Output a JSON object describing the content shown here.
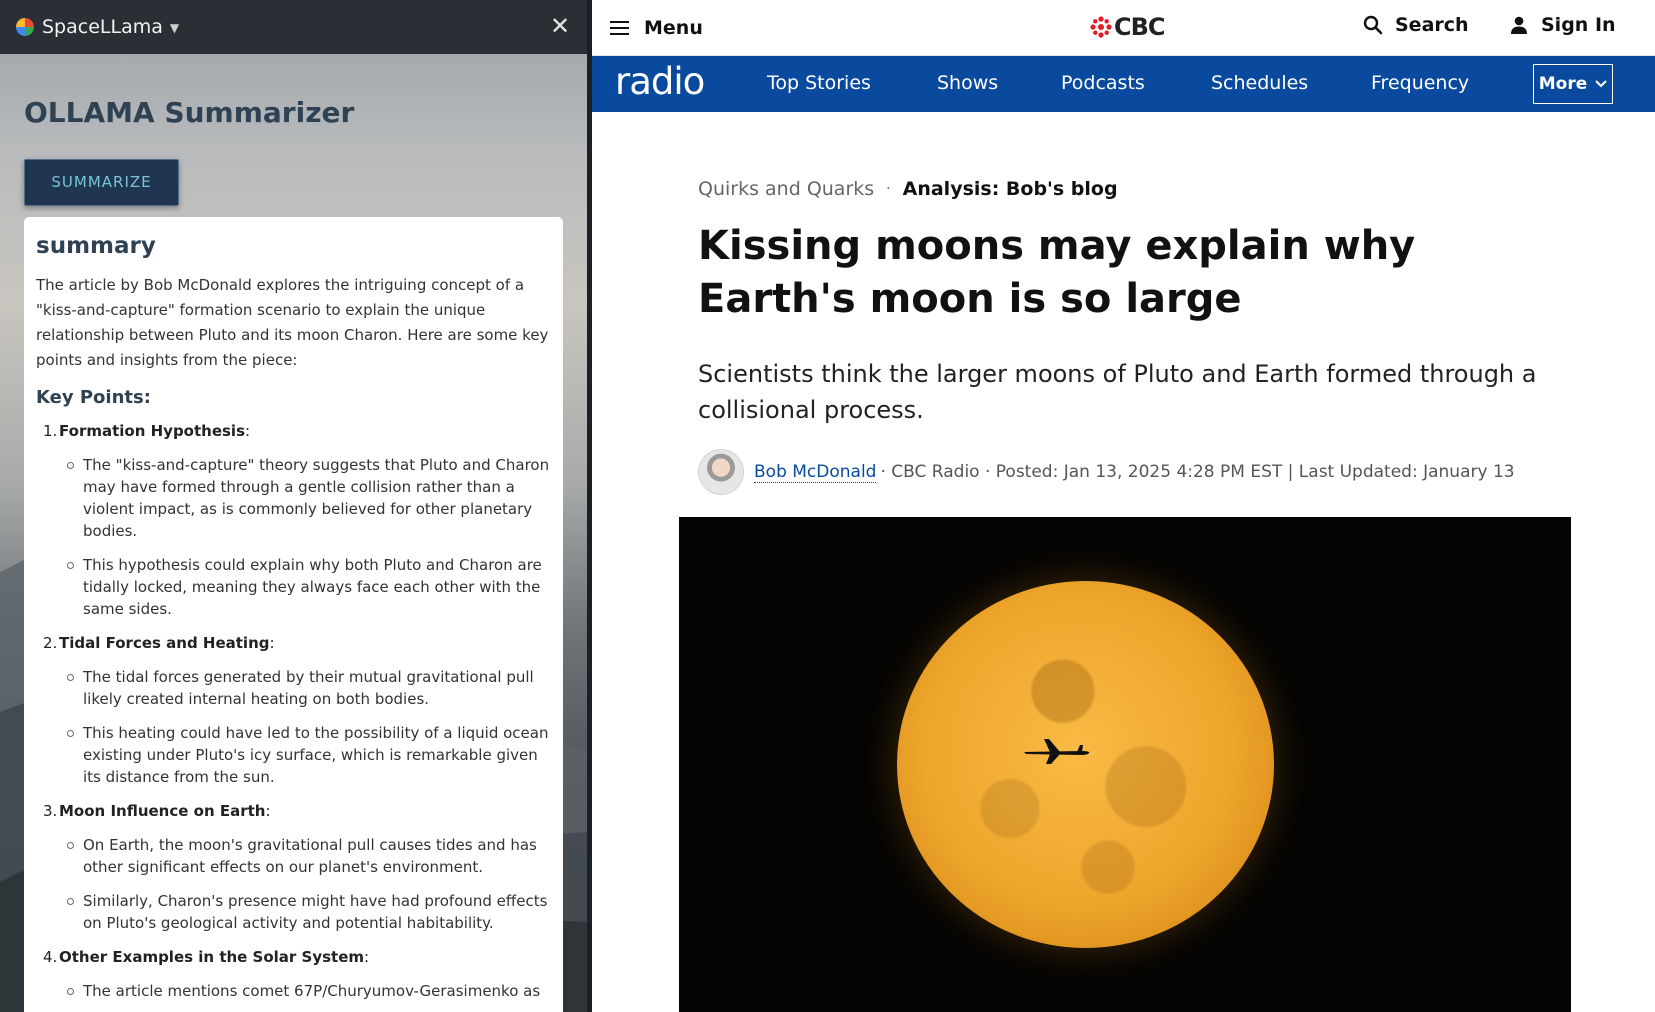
{
  "sidepanel": {
    "app_name": "SpaceLLama",
    "close_glyph": "✕",
    "title": "OLLAMA Summarizer",
    "summarize_button": "SUMMARIZE",
    "summary_heading": "summary",
    "intro": "The article by Bob McDonald explores the intriguing concept of a \"kiss-and-capture\" formation scenario to explain the unique relationship between Pluto and its moon Charon. Here are some key points and insights from the piece:",
    "key_points_heading": "Key Points:",
    "points": [
      {
        "num": "1.",
        "title": "Formation Hypothesis",
        "bullets": [
          "The \"kiss-and-capture\" theory suggests that Pluto and Charon may have formed through a gentle collision rather than a violent impact, as is commonly believed for other planetary bodies.",
          "This hypothesis could explain why both Pluto and Charon are tidally locked, meaning they always face each other with the same sides."
        ]
      },
      {
        "num": "2.",
        "title": "Tidal Forces and Heating",
        "bullets": [
          "The tidal forces generated by their mutual gravitational pull likely created internal heating on both bodies.",
          "This heating could have led to the possibility of a liquid ocean existing under Pluto's icy surface, which is remarkable given its distance from the sun."
        ]
      },
      {
        "num": "3.",
        "title": "Moon Influence on Earth",
        "bullets": [
          "On Earth, the moon's gravitational pull causes tides and has other significant effects on our planet's environment.",
          "Similarly, Charon's presence might have had profound effects on Pluto's geological activity and potential habitability."
        ]
      },
      {
        "num": "4.",
        "title": "Other Examples in the Solar System",
        "bullets": [
          "The article mentions comet 67P/Churyumov-Gerasimenko as"
        ]
      }
    ]
  },
  "cbc": {
    "menu_label": "Menu",
    "logo_text": "CBC",
    "search_label": "Search",
    "signin_label": "Sign In",
    "nav": {
      "brand": "radio",
      "items": [
        "Top Stories",
        "Shows",
        "Podcasts",
        "Schedules",
        "Frequency"
      ],
      "more_label": "More"
    },
    "article": {
      "show": "Quirks and Quarks",
      "separator": "·",
      "blog": "Analysis: Bob's blog",
      "headline": "Kissing moons may explain why Earth's moon is so large",
      "dek": "Scientists think the larger moons of Pluto and Earth formed through a collisional process.",
      "author": "Bob McDonald",
      "byline_rest": "· CBC Radio · Posted: Jan 13, 2025 4:28 PM EST | Last Updated: January 13"
    }
  },
  "colors": {
    "cbc_nav_blue": "#0a4a9e",
    "cbc_red": "#e21c24",
    "panel_header": "#2a2e35",
    "panel_title": "#2e4254",
    "moon_orange": "#eea62c"
  },
  "icons": {
    "menu": "hamburger-icon",
    "search": "search-icon",
    "signin": "person-icon",
    "more": "chevron-down-icon",
    "close": "close-icon"
  }
}
